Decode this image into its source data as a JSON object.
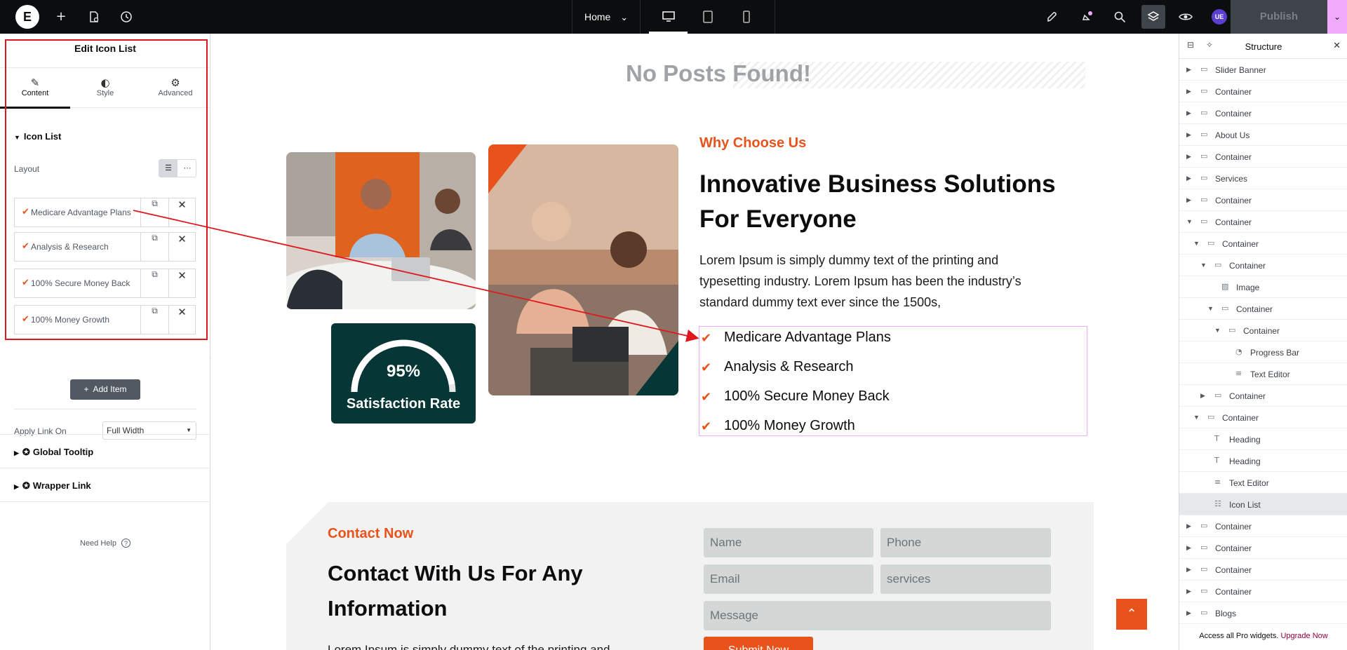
{
  "topbar": {
    "logo": "E",
    "page_name": "Home",
    "page_caret": "⌄",
    "user_initials": "UE",
    "publish_label": "Publish",
    "icons": [
      "plus-icon",
      "page-settings-icon",
      "history-icon",
      "launchpad-icon",
      "notifications-icon",
      "search-icon",
      "structure-icon",
      "preview-icon"
    ],
    "devices": [
      "desktop-icon",
      "tablet-icon",
      "mobile-icon"
    ]
  },
  "left_panel": {
    "title": "Edit Icon List",
    "tabs": [
      {
        "label": "Content",
        "icon": "pencil-icon"
      },
      {
        "label": "Style",
        "icon": "contrast-icon"
      },
      {
        "label": "Advanced",
        "icon": "gear-icon"
      }
    ],
    "section_title": "Icon List",
    "layout_label": "Layout",
    "items": [
      {
        "text": "Medicare Advantage Plans"
      },
      {
        "text": "Analysis & Research"
      },
      {
        "text": "100% Secure Money Back"
      },
      {
        "text": "100% Money Growth"
      }
    ],
    "add_item_label": "Add Item",
    "apply_link_label": "Apply Link On",
    "apply_link_value": "Full Width",
    "global_tooltip_label": "Global Tooltip",
    "wrapper_link_label": "Wrapper Link",
    "need_help_label": "Need Help"
  },
  "canvas": {
    "no_posts": "No Posts Found!",
    "stat_value": "95%",
    "stat_label": "Satisfaction Rate",
    "stat_progress": 0.95,
    "eyebrow": "Why Choose Us",
    "heading_line1": "Innovative Business Solutions",
    "heading_line2": "For Everyone",
    "para_line1": "Lorem Ipsum is simply dummy text of the printing and",
    "para_line2": "typesetting industry. Lorem Ipsum has been the industry’s",
    "para_line3": "standard dummy text ever since the 1500s,",
    "icon_list": [
      "Medicare Advantage Plans",
      "Analysis & Research",
      "100% Secure Money Back",
      "100% Money Growth"
    ],
    "contact_eyebrow": "Contact Now",
    "contact_heading_line1": "Contact With Us For Any",
    "contact_heading_line2": "Information",
    "contact_para": "Lorem Ipsum is simply dummy text of the printing and",
    "form": {
      "name": "Name",
      "phone": "Phone",
      "email": "Email",
      "services": "services",
      "message": "Message",
      "submit": "Submit Now"
    }
  },
  "structure": {
    "title": "Structure",
    "rows": [
      {
        "label": "Slider Banner",
        "depth": 0,
        "caret": "right",
        "icon": "container-icon"
      },
      {
        "label": "Container",
        "depth": 0,
        "caret": "right",
        "icon": "container-icon"
      },
      {
        "label": "Container",
        "depth": 0,
        "caret": "right",
        "icon": "container-icon"
      },
      {
        "label": "About Us",
        "depth": 0,
        "caret": "right",
        "icon": "container-icon"
      },
      {
        "label": "Container",
        "depth": 0,
        "caret": "right",
        "icon": "container-icon"
      },
      {
        "label": "Services",
        "depth": 0,
        "caret": "right",
        "icon": "container-icon"
      },
      {
        "label": "Container",
        "depth": 0,
        "caret": "right",
        "icon": "container-icon"
      },
      {
        "label": "Container",
        "depth": 0,
        "caret": "down",
        "icon": "container-icon"
      },
      {
        "label": "Container",
        "depth": 1,
        "caret": "down",
        "icon": "container-icon"
      },
      {
        "label": "Container",
        "depth": 2,
        "caret": "down",
        "icon": "container-icon"
      },
      {
        "label": "Image",
        "depth": 3,
        "caret": "none",
        "icon": "image-icon"
      },
      {
        "label": "Container",
        "depth": 3,
        "caret": "down",
        "icon": "container-icon"
      },
      {
        "label": "Container",
        "depth": 4,
        "caret": "down",
        "icon": "container-icon"
      },
      {
        "label": "Progress Bar",
        "depth": 5,
        "caret": "none",
        "icon": "progress-icon"
      },
      {
        "label": "Text Editor",
        "depth": 5,
        "caret": "none",
        "icon": "text-editor-icon"
      },
      {
        "label": "Container",
        "depth": 2,
        "caret": "right",
        "icon": "container-icon"
      },
      {
        "label": "Container",
        "depth": 1,
        "caret": "down",
        "icon": "container-icon"
      },
      {
        "label": "Heading",
        "depth": 2,
        "caret": "none",
        "icon": "heading-icon"
      },
      {
        "label": "Heading",
        "depth": 2,
        "caret": "none",
        "icon": "heading-icon"
      },
      {
        "label": "Text Editor",
        "depth": 2,
        "caret": "none",
        "icon": "text-editor-icon"
      },
      {
        "label": "Icon List",
        "depth": 2,
        "caret": "none",
        "icon": "icon-list-icon",
        "selected": true
      },
      {
        "label": "Container",
        "depth": 0,
        "caret": "right",
        "icon": "container-icon"
      },
      {
        "label": "Container",
        "depth": 0,
        "caret": "right",
        "icon": "container-icon"
      },
      {
        "label": "Container",
        "depth": 0,
        "caret": "right",
        "icon": "container-icon"
      },
      {
        "label": "Container",
        "depth": 0,
        "caret": "right",
        "icon": "container-icon"
      },
      {
        "label": "Blogs",
        "depth": 0,
        "caret": "right",
        "icon": "container-icon"
      }
    ],
    "footer_text": "Access all Pro widgets.",
    "footer_link": "Upgrade Now"
  },
  "colors": {
    "accent": "#e8531b",
    "dark_teal": "#063635",
    "annotation_red": "#e0181e",
    "selection_pink": "#f0abfc"
  }
}
